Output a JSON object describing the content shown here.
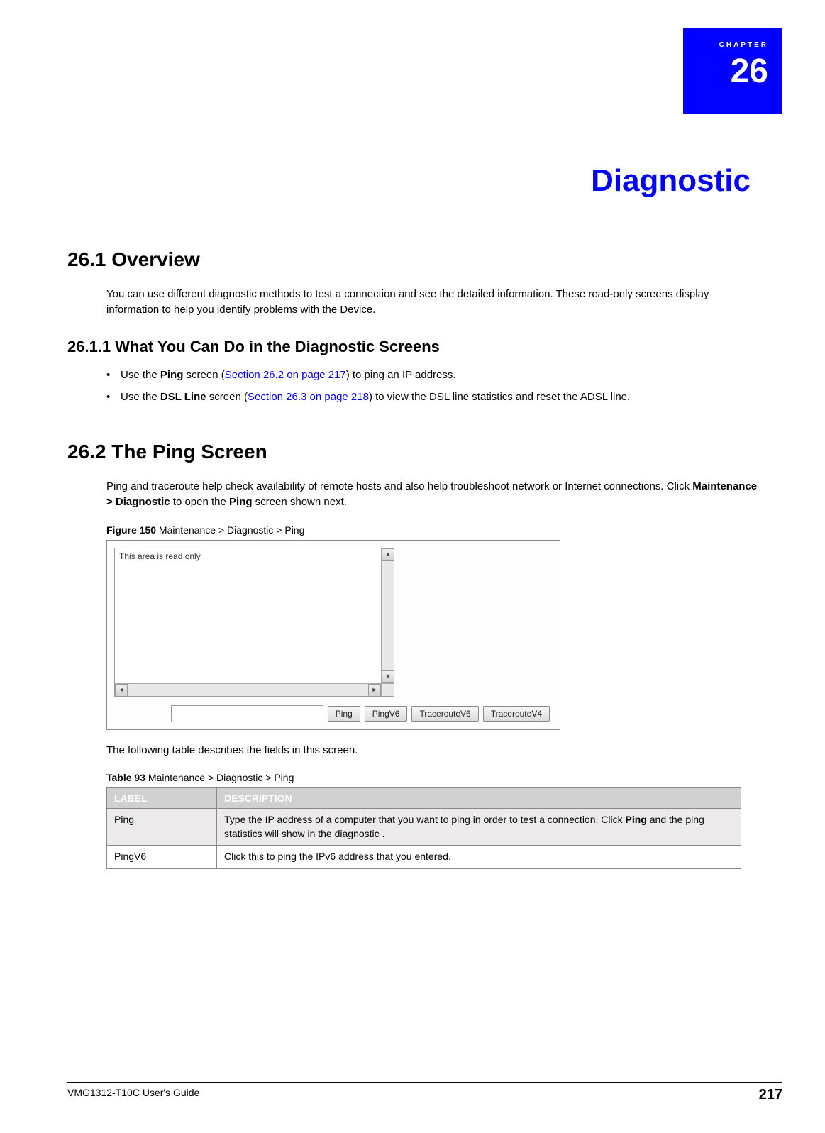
{
  "chapter": {
    "label": "CHAPTER",
    "number": "26",
    "title": "Diagnostic"
  },
  "section1": {
    "heading": "26.1  Overview",
    "para1": "You can use different diagnostic methods to test a connection and see the detailed information. These read-only screens display information to help you identify problems with the Device."
  },
  "section1_1": {
    "heading": "26.1.1  What You Can Do in the Diagnostic Screens",
    "bullets": [
      {
        "pre": "Use the ",
        "bold1": "Ping",
        "mid1": " screen (",
        "link": "Section 26.2 on page 217",
        "mid2": ") to ping an IP address."
      },
      {
        "pre": "Use the ",
        "bold1": "DSL Line",
        "mid1": " screen (",
        "link": "Section 26.3 on page 218",
        "mid2": ") to view the DSL line statistics and reset the ADSL line."
      }
    ]
  },
  "section2": {
    "heading": "26.2  The Ping Screen",
    "para1_a": "Ping and traceroute help check availability of remote hosts and also help troubleshoot network or Internet connections. Click ",
    "para1_bold": "Maintenance > Diagnostic",
    "para1_b": " to open the ",
    "para1_bold2": "Ping",
    "para1_c": " screen shown next.",
    "figure_caption_bold": "Figure 150",
    "figure_caption_rest": "   Maintenance > Diagnostic > Ping",
    "figure": {
      "readonly_label": "This area is read only.",
      "buttons": [
        "Ping",
        "PingV6",
        "TracerouteV6",
        "TracerouteV4"
      ]
    },
    "table_intro": "The following table describes the fields in this screen.",
    "table_caption_bold": "Table 93",
    "table_caption_rest": "   Maintenance > Diagnostic > Ping",
    "table_headers": {
      "c1": "LABEL",
      "c2": "DESCRIPTION"
    },
    "table_rows": [
      {
        "label": "Ping",
        "desc_a": "Type the IP address of a computer that you want to ping in order to test a connection. Click ",
        "desc_bold": "Ping",
        "desc_b": " and the ping statistics will show in the diagnostic ."
      },
      {
        "label": "PingV6",
        "desc_a": "Click this to ping the IPv6 address that you entered.",
        "desc_bold": "",
        "desc_b": ""
      }
    ]
  },
  "footer": {
    "left": "VMG1312-T10C User's Guide",
    "page": "217"
  }
}
